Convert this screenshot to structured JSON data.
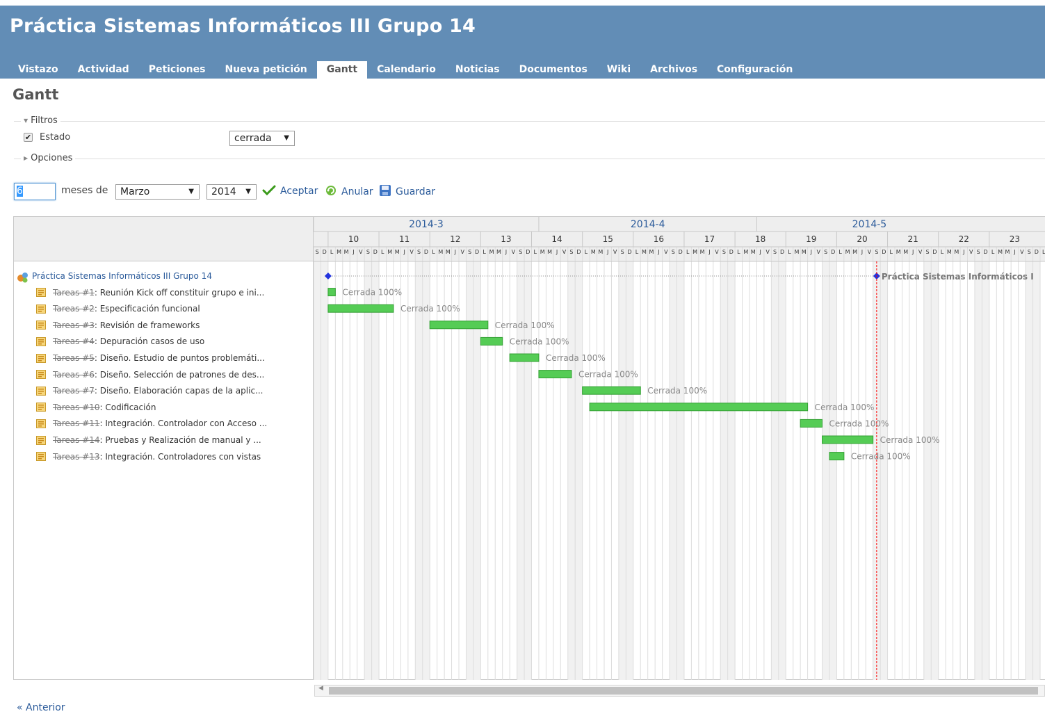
{
  "header": {
    "project_title": "Práctica Sistemas Informáticos III Grupo 14",
    "menu": [
      {
        "label": "Vistazo",
        "selected": false
      },
      {
        "label": "Actividad",
        "selected": false
      },
      {
        "label": "Peticiones",
        "selected": false
      },
      {
        "label": "Nueva petición",
        "selected": false
      },
      {
        "label": "Gantt",
        "selected": true
      },
      {
        "label": "Calendario",
        "selected": false
      },
      {
        "label": "Noticias",
        "selected": false
      },
      {
        "label": "Documentos",
        "selected": false
      },
      {
        "label": "Wiki",
        "selected": false
      },
      {
        "label": "Archivos",
        "selected": false
      },
      {
        "label": "Configuración",
        "selected": false
      }
    ]
  },
  "page": {
    "heading": "Gantt",
    "filters_legend": "Filtros",
    "options_legend": "Opciones",
    "filter_status_label": "Estado",
    "filter_status_checked": true,
    "filter_status_value": "cerrada",
    "months_value": "6",
    "months_label": "meses de",
    "month_select": "Marzo",
    "year_select": "2014",
    "accept_label": "Aceptar",
    "cancel_label": "Anular",
    "save_label": "Guardar",
    "previous_label": "« Anterior"
  },
  "gantt": {
    "project": {
      "name": "Práctica Sistemas Informáticos III Grupo 14",
      "label": "Práctica Sistemas Informáticos I"
    },
    "months": [
      "2014-3",
      "2014-4",
      "2014-5"
    ],
    "weeks": [
      "10",
      "11",
      "12",
      "13",
      "14",
      "15",
      "16",
      "17",
      "18",
      "19",
      "20",
      "21",
      "22",
      "23"
    ],
    "day_letters": [
      "L",
      "M",
      "M",
      "J",
      "V",
      "S",
      "D"
    ],
    "issues": [
      {
        "tracker": "Tareas #1",
        "subject": ": Reunión Kick off constituir grupo e ini...",
        "status_label": "Cerrada 100%"
      },
      {
        "tracker": "Tareas #2",
        "subject": ": Especificación funcional",
        "status_label": "Cerrada 100%"
      },
      {
        "tracker": "Tareas #3",
        "subject": ": Revisión de frameworks",
        "status_label": "Cerrada 100%"
      },
      {
        "tracker": "Tareas #4",
        "subject": ": Depuración casos de uso",
        "status_label": "Cerrada 100%"
      },
      {
        "tracker": "Tareas #5",
        "subject": ": Diseño. Estudio de puntos problemáti...",
        "status_label": "Cerrada 100%"
      },
      {
        "tracker": "Tareas #6",
        "subject": ": Diseño. Selección de patrones de des...",
        "status_label": "Cerrada 100%"
      },
      {
        "tracker": "Tareas #7",
        "subject": ": Diseño. Elaboración capas de la aplic...",
        "status_label": "Cerrada 100%"
      },
      {
        "tracker": "Tareas #10",
        "subject": ": Codificación",
        "status_label": "Cerrada 100%"
      },
      {
        "tracker": "Tareas #11",
        "subject": ": Integración. Controlador con Acceso ...",
        "status_label": "Cerrada 100%"
      },
      {
        "tracker": "Tareas #14",
        "subject": ": Pruebas y Realización de manual y ...",
        "status_label": "Cerrada 100%"
      },
      {
        "tracker": "Tareas #13",
        "subject": ": Integración. Controladores con vistas",
        "status_label": "Cerrada 100%"
      }
    ]
  },
  "colors": {
    "header": "#628db6",
    "bar": "#55cc55",
    "today_line": "#ff0000",
    "link": "#2a5a9a"
  }
}
